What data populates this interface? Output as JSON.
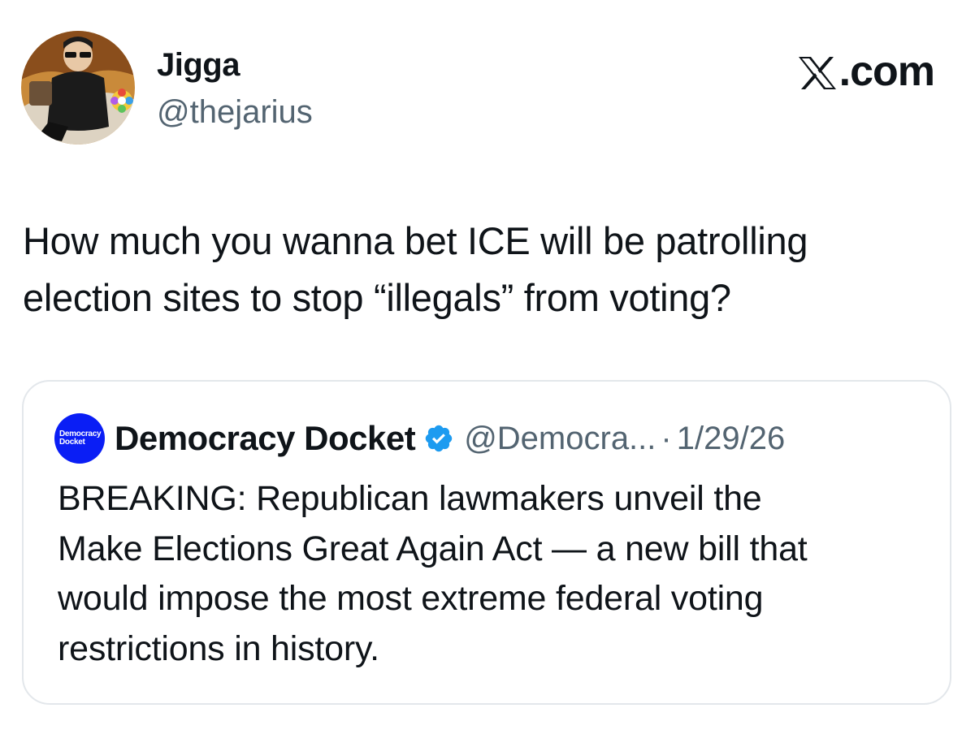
{
  "author": {
    "display_name": "Jigga",
    "handle": "@thejarius",
    "avatar_icon": "cartoon-avatar"
  },
  "brand": {
    "label": ".com",
    "icon": "x-logo-icon"
  },
  "tweet": {
    "text_line1": "How much you wanna bet ICE will be patrolling",
    "text_line2": "election sites to stop “illegals” from voting?"
  },
  "quoted_tweet": {
    "avatar_text_line1": "Democracy",
    "avatar_text_line2": "Docket",
    "avatar_color": "#0a1ef5",
    "display_name": "Democracy Docket",
    "verified": true,
    "verified_color": "#1d9bf0",
    "handle": "@Democra...",
    "separator": "·",
    "date": "1/29/26",
    "text_line1": "BREAKING: Republican lawmakers unveil the",
    "text_line2": "Make Elections Great Again Act — a new bill that",
    "text_line3": "would impose the most extreme federal voting",
    "text_line4": "restrictions in history."
  }
}
